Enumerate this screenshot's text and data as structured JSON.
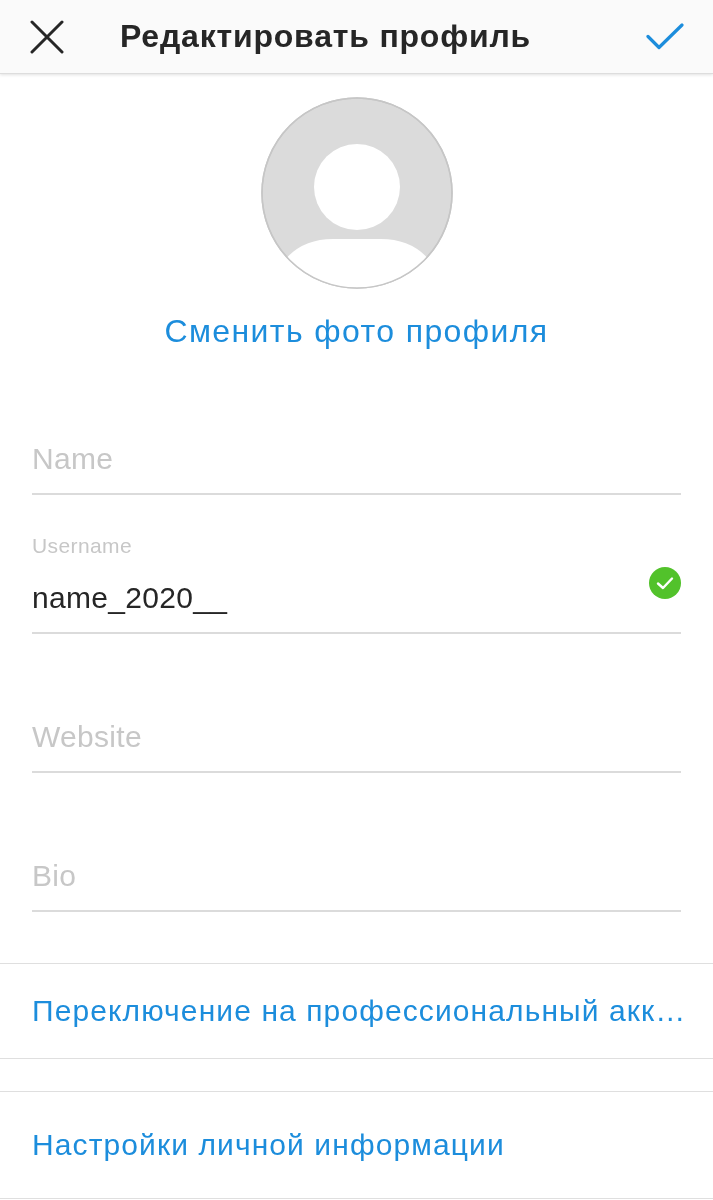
{
  "header": {
    "title": "Редактировать профиль"
  },
  "avatar": {
    "link": "Сменить фото профиля"
  },
  "fields": [
    {
      "placeholder": "Name"
    },
    {
      "label": "Username",
      "value": "name_2020__",
      "valid": true
    },
    {
      "placeholder": "Website"
    },
    {
      "placeholder": "Bio"
    }
  ],
  "links": [
    "Переключение на профессиональный акк…",
    "Настройки личной информации"
  ]
}
